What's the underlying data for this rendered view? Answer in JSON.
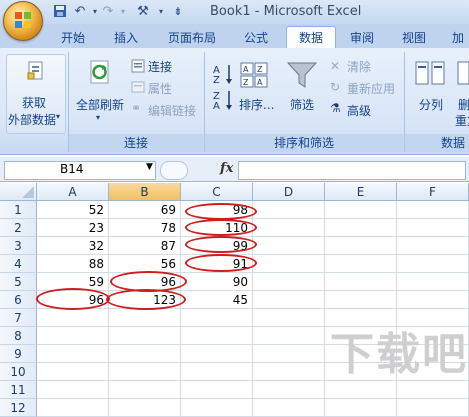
{
  "window": {
    "title": "Book1 - Microsoft Excel"
  },
  "tabs": [
    {
      "label": "开始"
    },
    {
      "label": "插入"
    },
    {
      "label": "页面布局"
    },
    {
      "label": "公式"
    },
    {
      "label": "数据",
      "active": true
    },
    {
      "label": "审阅"
    },
    {
      "label": "视图"
    },
    {
      "label": "加"
    }
  ],
  "ribbon": {
    "get_external": {
      "label1": "获取",
      "label2": "外部数据"
    },
    "refresh_all": "全部刷新",
    "connections": "连接",
    "properties": "属性",
    "edit_links": "编辑链接",
    "sort_az": "A\nZ",
    "sort": "排序...",
    "filter": "筛选",
    "clear": "清除",
    "reapply": "重新应用",
    "advanced": "高级",
    "split": "分列",
    "delete_partial": "删",
    "dup_partial": "重复",
    "group_connections": "连接",
    "group_sort_filter": "排序和筛选",
    "group_data_tools": "数据"
  },
  "formula_bar": {
    "name_box": "B14",
    "fx": "fx",
    "value": ""
  },
  "columns": [
    "A",
    "B",
    "C",
    "D",
    "E",
    "F"
  ],
  "rows": [
    {
      "n": "1",
      "a": "52",
      "b": "69",
      "c": "98"
    },
    {
      "n": "2",
      "a": "23",
      "b": "78",
      "c": "110"
    },
    {
      "n": "3",
      "a": "32",
      "b": "87",
      "c": "99"
    },
    {
      "n": "4",
      "a": "88",
      "b": "56",
      "c": "91"
    },
    {
      "n": "5",
      "a": "59",
      "b": "96",
      "c": "90"
    },
    {
      "n": "6",
      "a": "96",
      "b": "123",
      "c": "45"
    },
    {
      "n": "7",
      "a": "",
      "b": "",
      "c": ""
    },
    {
      "n": "8",
      "a": "",
      "b": "",
      "c": ""
    },
    {
      "n": "9",
      "a": "",
      "b": "",
      "c": ""
    },
    {
      "n": "10",
      "a": "",
      "b": "",
      "c": ""
    },
    {
      "n": "11",
      "a": "",
      "b": "",
      "c": ""
    },
    {
      "n": "12",
      "a": "",
      "b": "",
      "c": ""
    }
  ],
  "watermark": "下载吧",
  "colors": {
    "highlight_ellipse": "#cc1f1f",
    "selected_col": "#f1c15f",
    "accent": "#15428b"
  }
}
